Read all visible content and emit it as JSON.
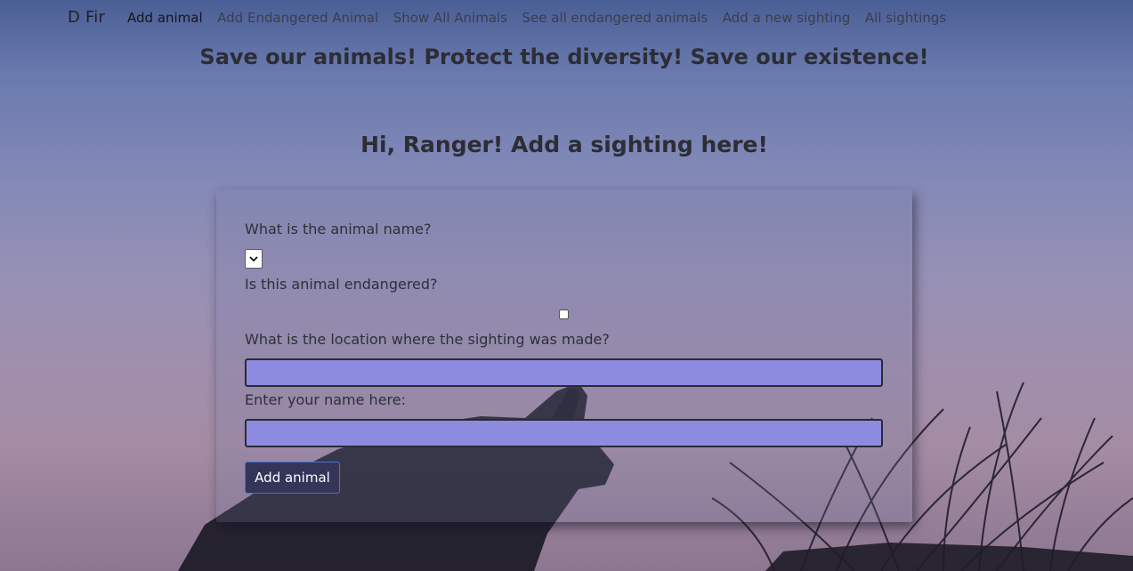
{
  "nav": {
    "brand": "D Fir",
    "links": [
      {
        "label": "Add animal",
        "active": true
      },
      {
        "label": "Add Endangered Animal"
      },
      {
        "label": "Show All Animals"
      },
      {
        "label": "See all endangered animals"
      },
      {
        "label": "Add a new sighting"
      },
      {
        "label": "All sightings"
      }
    ]
  },
  "main_heading": "Save our animals! Protect the diversity! Save our existence!",
  "sub_heading": "Hi, Ranger! Add a sighting here!",
  "form": {
    "animal_name_label": "What is the animal name?",
    "animal_select_value": "",
    "endangered_label": "Is this animal endangered?",
    "endangered_checked": false,
    "location_label": "What is the location where the sighting was made?",
    "location_value": "",
    "ranger_name_label": "Enter your name here:",
    "ranger_name_value": "",
    "submit_label": "Add animal"
  },
  "colors": {
    "input_fill": "#8d8be0",
    "button_fill": "#353559",
    "button_border": "#4a6fd8"
  },
  "icons": {
    "select_arrow": "chevron-down-icon"
  }
}
